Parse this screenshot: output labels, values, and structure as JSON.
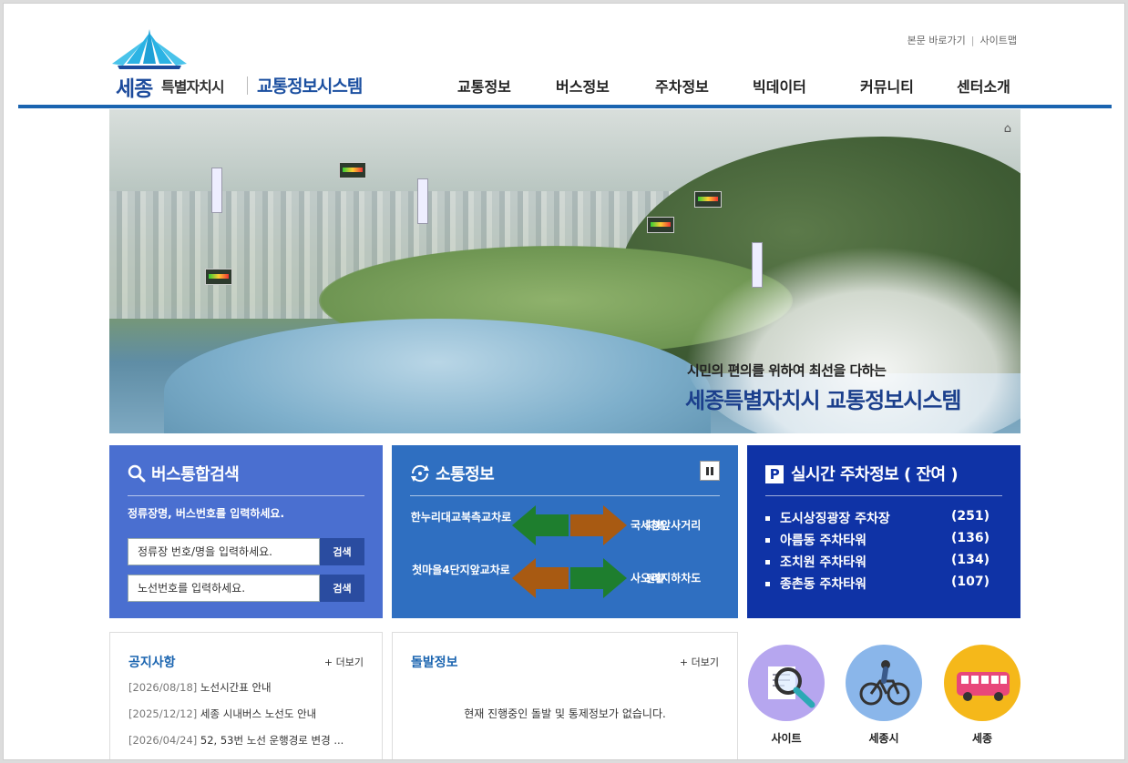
{
  "header": {
    "util_links": [
      "본문 바로가기",
      "사이트맵"
    ],
    "logo_main": "세종",
    "logo_sub": "특별자치시",
    "system_name": "교통정보시스템",
    "nav": [
      "교통정보",
      "버스정보",
      "주차정보",
      "빅데이터",
      "커뮤니티",
      "센터소개"
    ]
  },
  "banner": {
    "line1": "시민의 편의를 위하여 최선을 다하는",
    "line2": "세종특별자치시 교통정보시스템"
  },
  "bus_search": {
    "title": "버스통합검색",
    "guide": "정류장명, 버스번호를 입력하세요.",
    "stop_placeholder": "정류장 번호/명을 입력하세요.",
    "route_placeholder": "노선번호를 입력하세요.",
    "search_label": "검색"
  },
  "traffic": {
    "title": "소통정보",
    "roads": [
      {
        "from": "한누리대교북측교차로",
        "left_status": "원활",
        "right_status": "지체",
        "to": "국세청앞사거리"
      },
      {
        "from": "첫마을4단지앞교차로",
        "left_status": "지체",
        "right_status": "원활",
        "to": "사오리지하차도"
      }
    ],
    "colors": {
      "원활": "#1e7e2e",
      "지체": "#a85a12"
    }
  },
  "parking": {
    "title": "실시간 주차정보 ( 잔여 )",
    "icon_letter": "P",
    "items": [
      {
        "name": "도시상징광장 주차장",
        "count": "(251)"
      },
      {
        "name": "아름동 주차타워",
        "count": "(136)"
      },
      {
        "name": "조치원 주차타워",
        "count": "(134)"
      },
      {
        "name": "종촌동 주차타워",
        "count": "(107)"
      }
    ]
  },
  "notice": {
    "title": "공지사항",
    "more": "+ 더보기",
    "items": [
      {
        "date": "[2026/08/18]",
        "text": "노선시간표 안내"
      },
      {
        "date": "[2025/12/12]",
        "text": "세종 시내버스 노선도 안내"
      },
      {
        "date": "[2026/04/24]",
        "text": "52, 53번 노선 운행경로 변경 ..."
      }
    ]
  },
  "emergency": {
    "title": "돌발정보",
    "more": "+ 더보기",
    "message": "현재 진행중인 돌발 및 통제정보가 없습니다."
  },
  "quick_links": [
    {
      "label": "사이트",
      "icon": "magnifier-document-icon",
      "color": "#b6a6ef"
    },
    {
      "label": "세종시",
      "icon": "bicycle-icon",
      "color": "#8ab6ea"
    },
    {
      "label": "세종",
      "icon": "bus-icon",
      "color": "#f5b81a"
    }
  ],
  "theme": {
    "accent": "#1a64b0",
    "bus_box": "#4a6fd0",
    "traffic_box": "#2f6fc1",
    "parking_box": "#0f33a6"
  }
}
